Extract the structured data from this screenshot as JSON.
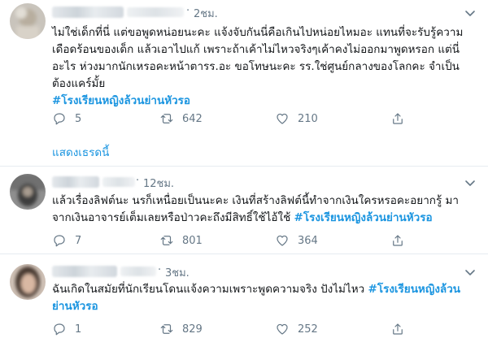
{
  "tweets": [
    {
      "time": "2ชม.",
      "text_main": "ไม่ใช่เด็กที่นี่ แต่ขอพูดหน่อยนะคะ แจ้งจับกันนี่คือเกินไปหน่อยไหมอะ แทนที่จะรับรู้ความเดือดร้อนของเด็ก แล้วเอาไปแก้ เพราะถ้าเค้าไม่ไหวจริงๆเค้าคงไม่ออกมาพูดหรอก แต่นี่อะไร ห่วงมากนักเหรอคะหน้าตารร.อะ ขอโทษนะคะ รร.ใช่ศูนย์กลางของโลกคะ จำเป็นต้องแคร์มั้ย",
      "hashtag": "#โรงเรียนหญิงล้วนย่านหัวรอ",
      "replies": "5",
      "retweets": "642",
      "likes": "210"
    },
    {
      "time": "12ชม.",
      "text_main": "แล้วเรื่องลิฟต์นะ นรก็เหนื่อยเป็นนะคะ เงินที่สร้างลิฟต์นี้ทำจากเงินใครหรอคะอยากรู้ มาจากเงินอาจารย์เต็มเลยหรือป่าวคะถึงมีสิทธิ์ใช้ไอ้ใช้",
      "hashtag": "#โรงเรียนหญิงล้วนย่านหัวรอ",
      "replies": "7",
      "retweets": "801",
      "likes": "364"
    },
    {
      "time": "3ชม.",
      "text_main": "ฉันเกิดในสมัยที่นักเรียนโดนแจ้งความเพราะพูดความจริง ปังไม่ไหว",
      "hashtag": "#โรงเรียนหญิงล้วนย่านหัวรอ",
      "replies": "1",
      "retweets": "829",
      "likes": "252"
    }
  ],
  "thread_link": "แสดงเธรดนี้",
  "dot": "·"
}
